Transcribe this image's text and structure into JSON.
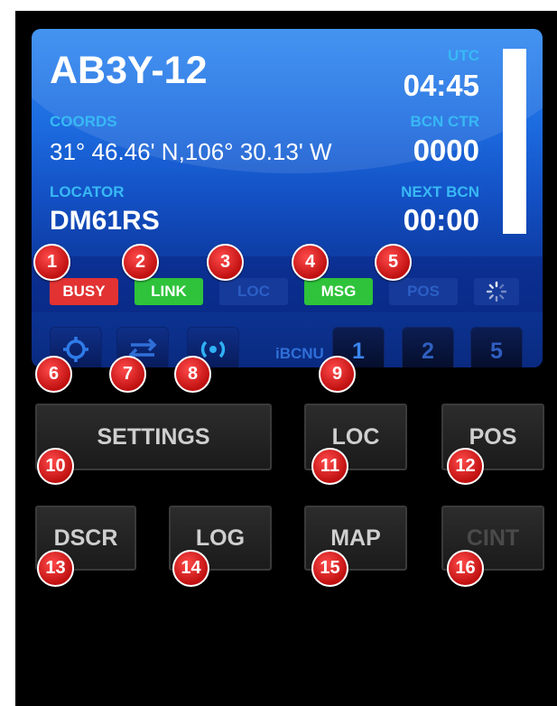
{
  "header": {
    "callsign": "AB3Y-12",
    "coords_label": "COORDS",
    "coords_value": "31° 46.46' N,106° 30.13' W",
    "locator_label": "LOCATOR",
    "locator_value": "DM61RS",
    "utc_label": "UTC",
    "utc_value": "04:45",
    "bcn_ctr_label": "BCN CTR",
    "bcn_ctr_value": "0000",
    "next_bcn_label": "NEXT BCN",
    "next_bcn_value": "00:00"
  },
  "indicators": {
    "busy": "BUSY",
    "link": "LINK",
    "loc": "LOC",
    "msg": "MSG",
    "pos": "POS",
    "spinner_icon": "spinner-icon"
  },
  "icon_row": {
    "gear_icon": "gear-icon",
    "link_icon": "swap-arrows-icon",
    "beacon_icon": "beacon-icon",
    "ibcnu_label": "iBCNU",
    "num_buttons": [
      "1",
      "2",
      "5"
    ]
  },
  "buttons": {
    "settings": "SETTINGS",
    "loc": "LOC",
    "pos": "POS",
    "dscr": "DSCR",
    "log": "LOG",
    "map": "MAP",
    "cint": "CINT"
  },
  "callouts": [
    "1",
    "2",
    "3",
    "4",
    "5",
    "6",
    "7",
    "8",
    "9",
    "10",
    "11",
    "12",
    "13",
    "14",
    "15",
    "16"
  ],
  "colors": {
    "busy": "#e23232",
    "active_green": "#2ec33a",
    "panel_blue": "#1c6ce0",
    "label_cyan": "#38b9f5",
    "callout_red": "#c01010"
  }
}
